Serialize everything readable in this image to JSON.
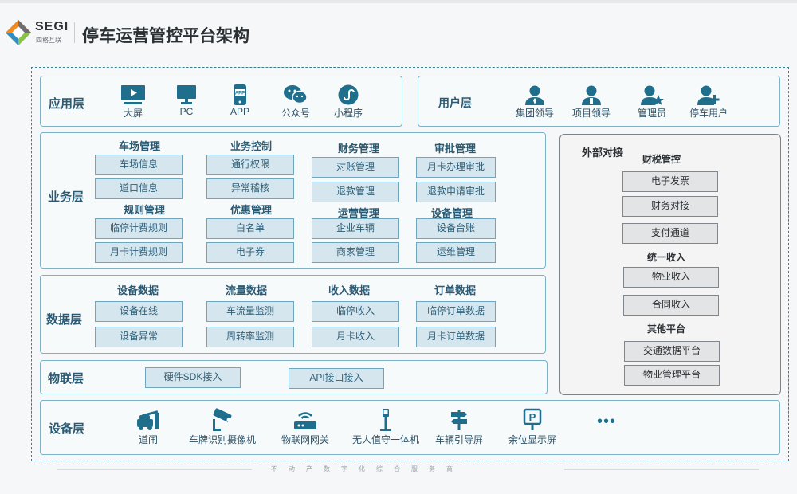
{
  "brand": {
    "name": "SEGI",
    "subtitle": "四格互联"
  },
  "page_title": "停车运营管控平台架构",
  "colors": {
    "accent": "#2f7d96",
    "box_fill": "#d5e6ee",
    "gray_box": "#e3e4e5"
  },
  "app_layer": {
    "label": "应用层",
    "items": [
      {
        "label": "大屏",
        "icon": "tv-screen-icon"
      },
      {
        "label": "PC",
        "icon": "monitor-icon"
      },
      {
        "label": "APP",
        "icon": "phone-app-icon"
      },
      {
        "label": "公众号",
        "icon": "wechat-icon"
      },
      {
        "label": "小程序",
        "icon": "mini-program-icon"
      }
    ]
  },
  "user_layer": {
    "label": "用户层",
    "items": [
      {
        "label": "集团领导",
        "icon": "leader-icon"
      },
      {
        "label": "项目领导",
        "icon": "manager-icon"
      },
      {
        "label": "管理员",
        "icon": "admin-star-icon"
      },
      {
        "label": "停车用户",
        "icon": "add-user-icon"
      }
    ]
  },
  "business_layer": {
    "label": "业务层",
    "groups": [
      {
        "title": "车场管理",
        "items": [
          "车场信息",
          "道口信息"
        ]
      },
      {
        "title": "业务控制",
        "items": [
          "通行权限",
          "异常稽核"
        ]
      },
      {
        "title": "财务管理",
        "items": [
          "对账管理",
          "退款管理"
        ]
      },
      {
        "title": "审批管理",
        "items": [
          "月卡办理审批",
          "退款申请审批"
        ]
      },
      {
        "title": "规则管理",
        "items": [
          "临停计费规则",
          "月卡计费规则"
        ]
      },
      {
        "title": "优惠管理",
        "items": [
          "白名单",
          "电子券"
        ]
      },
      {
        "title": "运营管理",
        "items": [
          "企业车辆",
          "商家管理"
        ]
      },
      {
        "title": "设备管理",
        "items": [
          "设备台账",
          "运维管理"
        ]
      }
    ]
  },
  "data_layer": {
    "label": "数据层",
    "groups": [
      {
        "title": "设备数据",
        "items": [
          "设备在线",
          "设备异常"
        ]
      },
      {
        "title": "流量数据",
        "items": [
          "车流量监测",
          "周转率监测"
        ]
      },
      {
        "title": "收入数据",
        "items": [
          "临停收入",
          "月卡收入"
        ]
      },
      {
        "title": "订单数据",
        "items": [
          "临停订单数据",
          "月卡订单数据"
        ]
      }
    ]
  },
  "iot_layer": {
    "label": "物联层",
    "items": [
      "硬件SDK接入",
      "API接口接入"
    ]
  },
  "device_layer": {
    "label": "设备层",
    "items": [
      {
        "label": "道闸",
        "icon": "barrier-gate-icon"
      },
      {
        "label": "车牌识别摄像机",
        "icon": "camera-icon"
      },
      {
        "label": "物联网网关",
        "icon": "router-icon"
      },
      {
        "label": "无人值守一体机",
        "icon": "kiosk-icon"
      },
      {
        "label": "车辆引导屏",
        "icon": "guide-sign-icon"
      },
      {
        "label": "余位显示屏",
        "icon": "parking-display-icon"
      },
      {
        "label": "•••",
        "icon": "more-icon"
      }
    ]
  },
  "external": {
    "title": "外部对接",
    "sections": [
      {
        "title": "财税管控",
        "items": [
          "电子发票",
          "财务对接",
          "支付通道"
        ]
      },
      {
        "title": "统一收入",
        "items": [
          "物业收入",
          "合同收入"
        ]
      },
      {
        "title": "其他平台",
        "items": [
          "交通数据平台",
          "物业管理平台"
        ]
      }
    ]
  },
  "footer": "不动产数字化综合服务商"
}
